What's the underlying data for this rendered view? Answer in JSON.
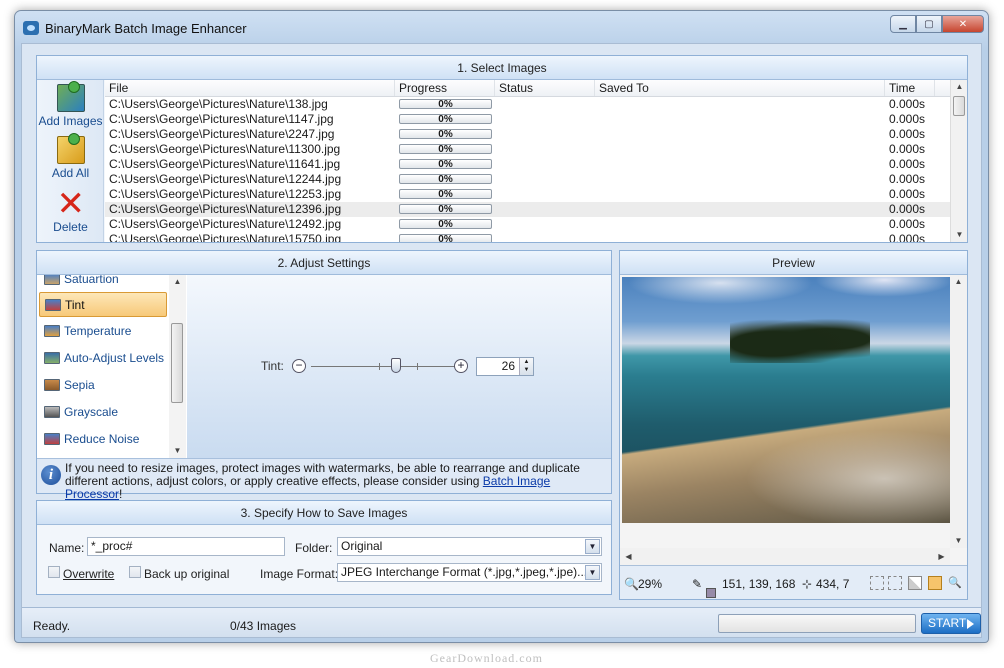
{
  "window": {
    "title": "BinaryMark Batch Image Enhancer"
  },
  "section1": {
    "header": "1. Select Images",
    "tools": {
      "add_images": "Add Images",
      "add_all": "Add All",
      "delete": "Delete"
    },
    "columns": {
      "file": "File",
      "progress": "Progress",
      "status": "Status",
      "saved_to": "Saved To",
      "time": "Time"
    },
    "rows": [
      {
        "file": "C:\\Users\\George\\Pictures\\Nature\\138.jpg",
        "progress": "0%",
        "time": "0.000s"
      },
      {
        "file": "C:\\Users\\George\\Pictures\\Nature\\1147.jpg",
        "progress": "0%",
        "time": "0.000s"
      },
      {
        "file": "C:\\Users\\George\\Pictures\\Nature\\2247.jpg",
        "progress": "0%",
        "time": "0.000s"
      },
      {
        "file": "C:\\Users\\George\\Pictures\\Nature\\11300.jpg",
        "progress": "0%",
        "time": "0.000s"
      },
      {
        "file": "C:\\Users\\George\\Pictures\\Nature\\11641.jpg",
        "progress": "0%",
        "time": "0.000s"
      },
      {
        "file": "C:\\Users\\George\\Pictures\\Nature\\12244.jpg",
        "progress": "0%",
        "time": "0.000s"
      },
      {
        "file": "C:\\Users\\George\\Pictures\\Nature\\12253.jpg",
        "progress": "0%",
        "time": "0.000s"
      },
      {
        "file": "C:\\Users\\George\\Pictures\\Nature\\12396.jpg",
        "progress": "0%",
        "time": "0.000s"
      },
      {
        "file": "C:\\Users\\George\\Pictures\\Nature\\12492.jpg",
        "progress": "0%",
        "time": "0.000s"
      },
      {
        "file": "C:\\Users\\George\\Pictures\\Nature\\15750.jpg",
        "progress": "0%",
        "time": "0.000s"
      }
    ]
  },
  "section2": {
    "header": "2. Adjust Settings",
    "items": [
      "Satuartion",
      "Tint",
      "Temperature",
      "Auto-Adjust Levels",
      "Sepia",
      "Grayscale",
      "Reduce Noise"
    ],
    "active_item": "Tint",
    "tint": {
      "label": "Tint:",
      "value": "26"
    },
    "info": {
      "text": "If you need to resize images, protect images with watermarks, be able to rearrange and duplicate different actions, adjust colors, or apply creative effects, please consider using ",
      "link": "Batch Image Processor",
      "suffix": "!"
    }
  },
  "preview": {
    "header": "Preview",
    "zoom": "29%",
    "color_values": "151, 139, 168",
    "coords": "434, 7",
    "swatch_color": "#978ba8"
  },
  "section3": {
    "header": "3. Specify How to Save Images",
    "name_label": "Name:",
    "name_value": "*_proc#",
    "folder_label": "Folder:",
    "folder_value": "Original",
    "overwrite_label": "Overwrite",
    "backup_label": "Back up original",
    "format_label": "Image Format:",
    "format_value": "JPEG Interchange Format (*.jpg,*.jpeg,*.jpe)..."
  },
  "statusbar": {
    "status": "Ready.",
    "count": "0/43 Images",
    "start": "START"
  },
  "watermark": "GearDownload.com"
}
